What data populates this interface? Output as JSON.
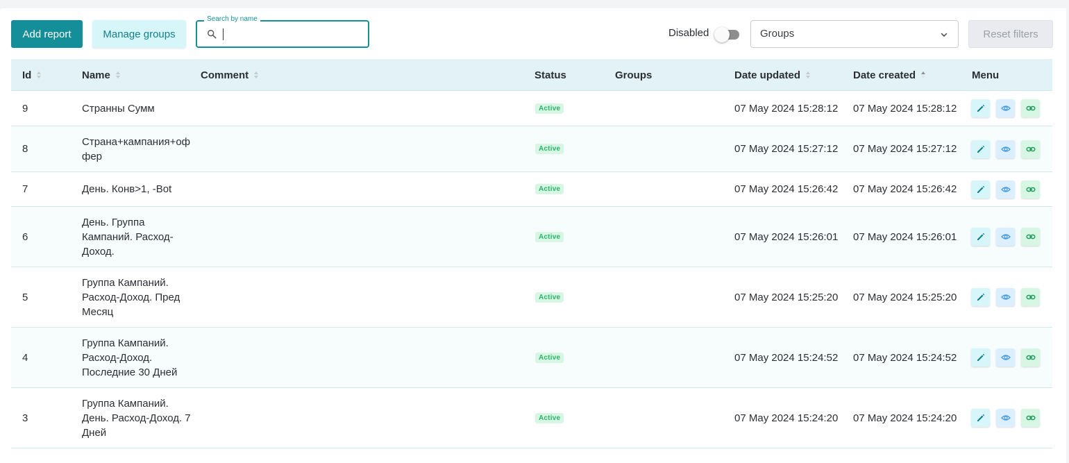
{
  "toolbar": {
    "add_label": "Add report",
    "manage_label": "Manage groups",
    "search_label": "Search by name",
    "search_value": "",
    "disabled_label": "Disabled",
    "disabled_on": false,
    "groups_value": "Groups",
    "reset_label": "Reset filters"
  },
  "table": {
    "columns": [
      "Id",
      "Name",
      "Comment",
      "Status",
      "Groups",
      "Date updated",
      "Date created",
      "Menu"
    ],
    "rows": [
      {
        "id": "9",
        "name": "Странны Сумм",
        "comment": "",
        "status": "Active",
        "groups": "",
        "updated": "07 May 2024 15:28:12",
        "created": "07 May 2024 15:28:12"
      },
      {
        "id": "8",
        "name": "Страна+кампания+оф фер",
        "comment": "",
        "status": "Active",
        "groups": "",
        "updated": "07 May 2024 15:27:12",
        "created": "07 May 2024 15:27:12"
      },
      {
        "id": "7",
        "name": "День. Конв>1, -Bot",
        "comment": "",
        "status": "Active",
        "groups": "",
        "updated": "07 May 2024 15:26:42",
        "created": "07 May 2024 15:26:42"
      },
      {
        "id": "6",
        "name": "День. Группа Кампаний. Расход-Доход.",
        "comment": "",
        "status": "Active",
        "groups": "",
        "updated": "07 May 2024 15:26:01",
        "created": "07 May 2024 15:26:01"
      },
      {
        "id": "5",
        "name": "Группа Кампаний. Расход-Доход. Пред Месяц",
        "comment": "",
        "status": "Active",
        "groups": "",
        "updated": "07 May 2024 15:25:20",
        "created": "07 May 2024 15:25:20"
      },
      {
        "id": "4",
        "name": "Группа Кампаний. Расход-Доход. Последние 30 Дней",
        "comment": "",
        "status": "Active",
        "groups": "",
        "updated": "07 May 2024 15:24:52",
        "created": "07 May 2024 15:24:52"
      },
      {
        "id": "3",
        "name": "Группа Кампаний. День. Расход-Доход. 7 Дней",
        "comment": "",
        "status": "Active",
        "groups": "",
        "updated": "07 May 2024 15:24:20",
        "created": "07 May 2024 15:24:20"
      }
    ]
  },
  "icons": {
    "search": "search-icon",
    "chevron": "chevron-down-icon",
    "sort": "sort-icon",
    "edit": "pencil-icon",
    "view": "eye-icon",
    "link": "link-icon"
  },
  "colors": {
    "accent": "#148f9a",
    "header_bg": "#e3f2f6",
    "badge_bg": "#d8f6e4",
    "badge_text": "#2bb46a"
  }
}
